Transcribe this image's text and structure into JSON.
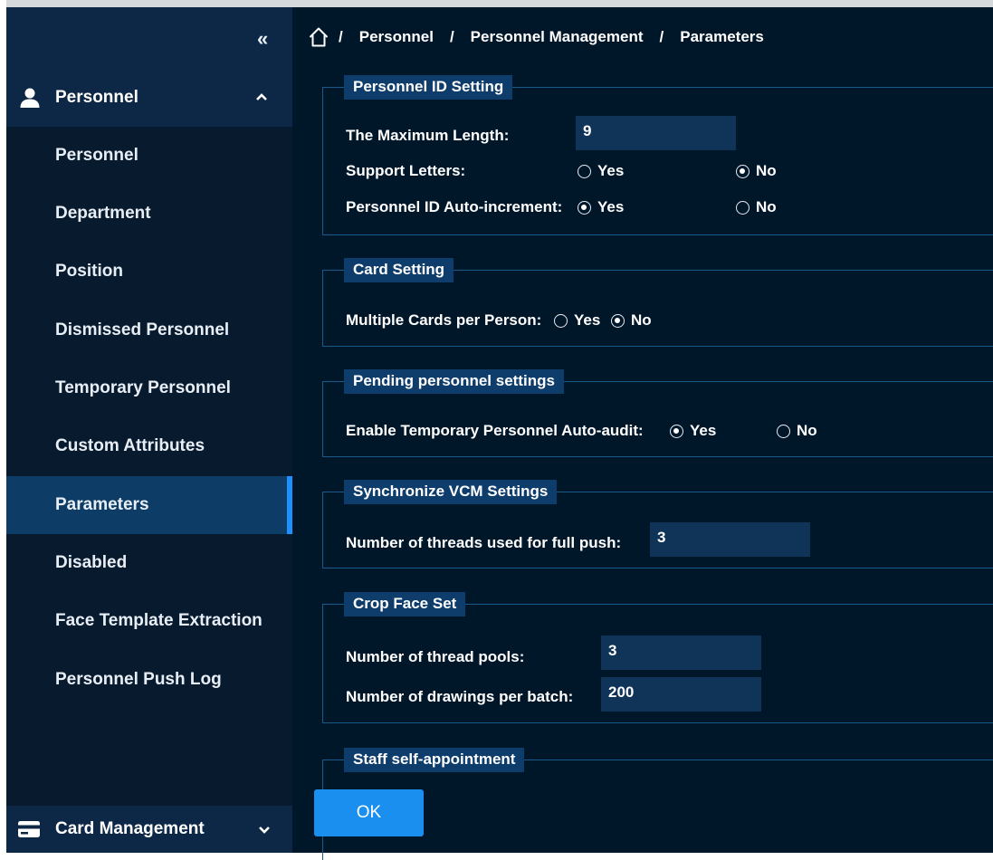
{
  "sidebar": {
    "collapse_glyph": "«",
    "group": {
      "label": "Personnel",
      "icon": "person-icon"
    },
    "items": [
      {
        "label": "Personnel"
      },
      {
        "label": "Department"
      },
      {
        "label": "Position"
      },
      {
        "label": "Dismissed Personnel"
      },
      {
        "label": "Temporary Personnel"
      },
      {
        "label": "Custom Attributes"
      },
      {
        "label": "Parameters",
        "active": true
      },
      {
        "label": "Disabled"
      },
      {
        "label": "Face Template Extraction"
      },
      {
        "label": "Personnel Push Log"
      }
    ],
    "bottom": {
      "label": "Card Management",
      "icon": "card-icon"
    }
  },
  "breadcrumb": {
    "sep": "/",
    "items": [
      "Personnel",
      "Personnel Management",
      "Parameters"
    ]
  },
  "sections": {
    "personnel_id": {
      "legend": "Personnel ID Setting",
      "max_length_label": "The Maximum Length:",
      "max_length_value": "9",
      "support_letters_label": "Support Letters:",
      "support_letters_options": [
        "Yes",
        "No"
      ],
      "support_letters_selected": "No",
      "auto_increment_label": "Personnel ID Auto-increment:",
      "auto_increment_options": [
        "Yes",
        "No"
      ],
      "auto_increment_selected": "Yes"
    },
    "card": {
      "legend": "Card Setting",
      "multiple_cards_label": "Multiple Cards per Person:",
      "multiple_cards_options": [
        "Yes",
        "No"
      ],
      "multiple_cards_selected": "No"
    },
    "pending": {
      "legend": "Pending personnel settings",
      "auto_audit_label": "Enable Temporary Personnel Auto-audit:",
      "auto_audit_options": [
        "Yes",
        "No"
      ],
      "auto_audit_selected": "Yes"
    },
    "vcm": {
      "legend": "Synchronize VCM Settings",
      "threads_label": "Number of threads used for full push:",
      "threads_value": "3"
    },
    "crop_face": {
      "legend": "Crop Face Set",
      "pools_label": "Number of thread pools:",
      "pools_value": "3",
      "drawings_label": "Number of drawings per batch:",
      "drawings_value": "200"
    },
    "self_appointment": {
      "legend": "Staff self-appointment"
    }
  },
  "ok_button": "OK",
  "colors": {
    "sidebar_bg": "#081a2e",
    "main_bg": "#001629",
    "active_item": "#0d3d66",
    "accent": "#1e90ff",
    "legend_bg": "#0e3d6b",
    "input_bg": "#0f3457",
    "border": "#1a5a8a"
  }
}
